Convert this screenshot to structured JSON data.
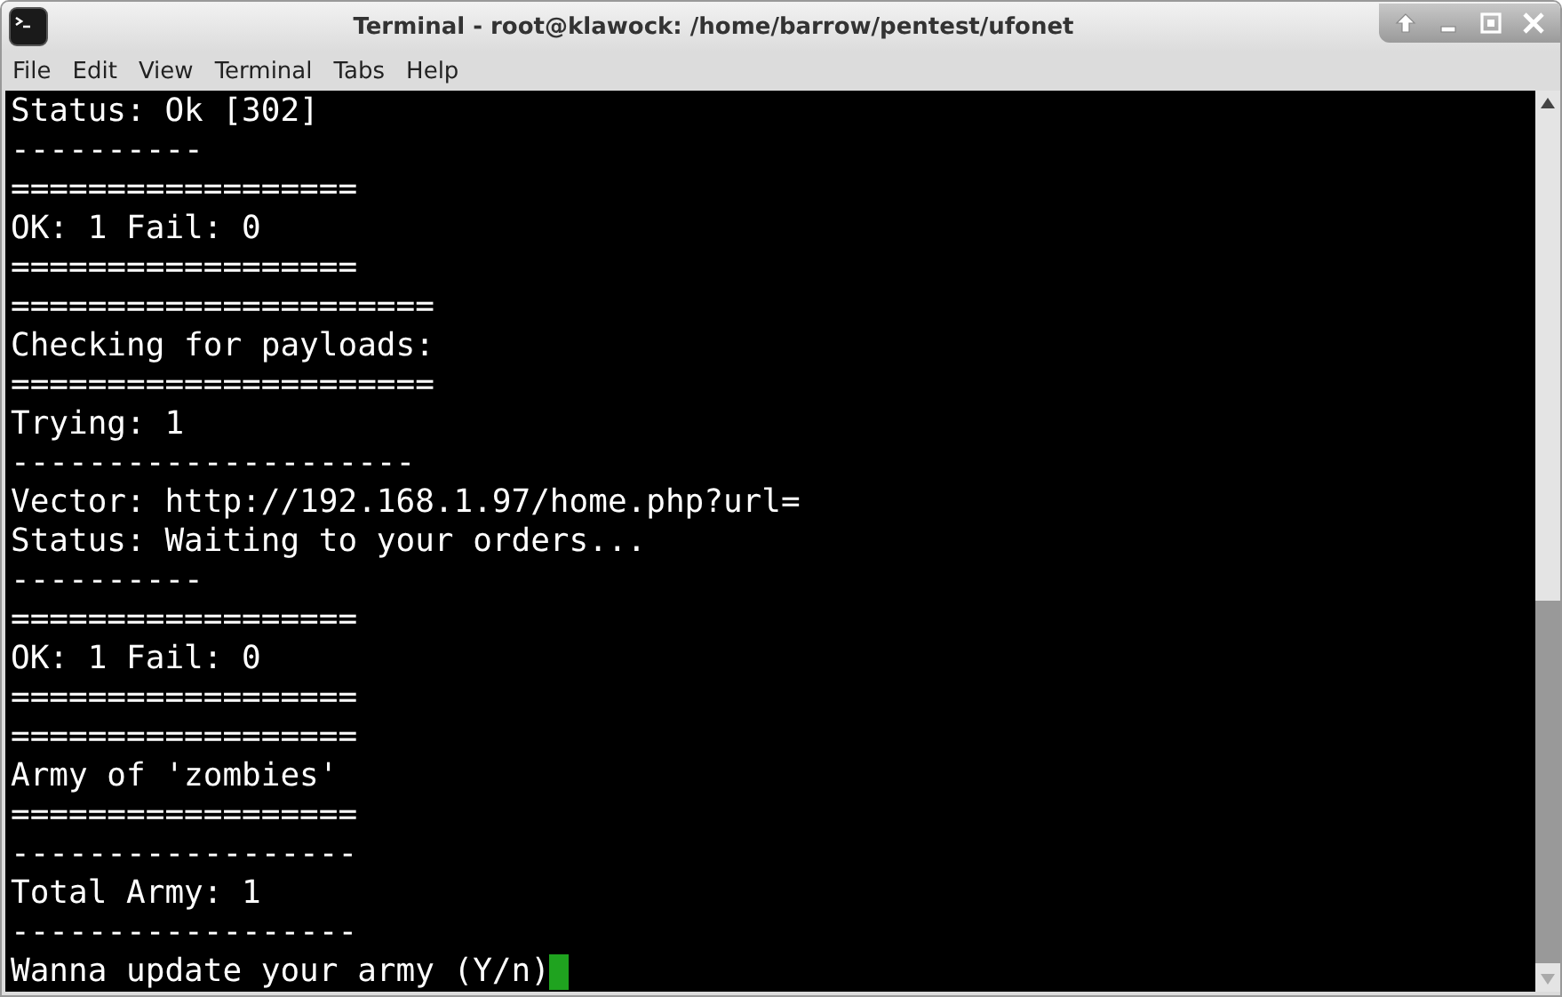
{
  "window": {
    "title": "Terminal - root@klawock: /home/barrow/pentest/ufonet"
  },
  "menu": [
    "File",
    "Edit",
    "View",
    "Terminal",
    "Tabs",
    "Help"
  ],
  "terminal": {
    "lines": [
      "Status: Ok [302]",
      "----------",
      "==================",
      "OK: 1 Fail: 0",
      "==================",
      "======================",
      "Checking for payloads:",
      "======================",
      "Trying: 1",
      "---------------------",
      "Vector: http://192.168.1.97/home.php?url=",
      "Status: Waiting to your orders...",
      "----------",
      "==================",
      "OK: 1 Fail: 0",
      "==================",
      "==================",
      "Army of 'zombies'",
      "==================",
      "------------------",
      "Total Army: 1",
      "------------------",
      "Wanna update your army (Y/n)"
    ],
    "cursor": true
  }
}
